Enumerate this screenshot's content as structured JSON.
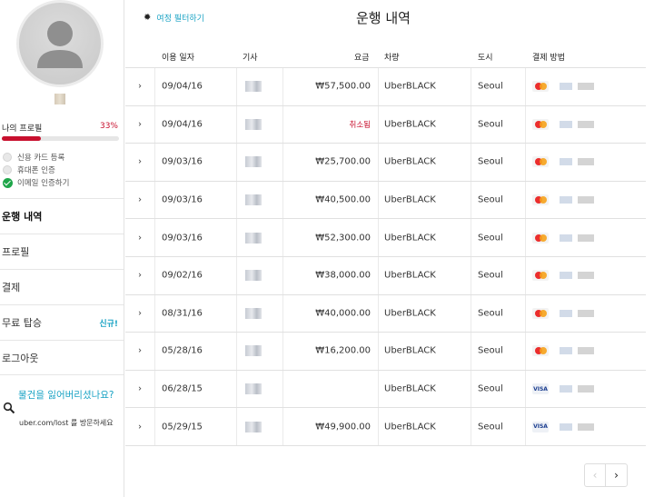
{
  "sidebar": {
    "profile_label": "나의 프로필",
    "profile_percent": "33%",
    "profile_progress": 0.33,
    "tasks": [
      {
        "label": "신용 카드 등록",
        "done": false
      },
      {
        "label": "휴대폰 인증",
        "done": false
      },
      {
        "label": "이메일 인증하기",
        "done": true
      }
    ],
    "nav": [
      {
        "label": "운행 내역",
        "active": true,
        "badge": ""
      },
      {
        "label": "프로필",
        "active": false,
        "badge": ""
      },
      {
        "label": "결제",
        "active": false,
        "badge": ""
      },
      {
        "label": "무료 탑승",
        "active": false,
        "badge": "신규!"
      },
      {
        "label": "로그아웃",
        "active": false,
        "badge": ""
      }
    ],
    "lost_title": "물건을 잃어버리셨나요?",
    "lost_sub": "uber.com/lost 를 방문하세요"
  },
  "header": {
    "filter_label": "여정 필터하기",
    "title": "운행 내역"
  },
  "table": {
    "columns": [
      "이용 일자",
      "기사",
      "요금",
      "차량",
      "도시",
      "결제 방법"
    ],
    "rows": [
      {
        "date": "09/04/16",
        "fare": "₩57,500.00",
        "cancelled": false,
        "vehicle": "UberBLACK",
        "city": "Seoul",
        "card": "mastercard"
      },
      {
        "date": "09/04/16",
        "fare": "취소됨",
        "cancelled": true,
        "vehicle": "UberBLACK",
        "city": "Seoul",
        "card": "mastercard"
      },
      {
        "date": "09/03/16",
        "fare": "₩25,700.00",
        "cancelled": false,
        "vehicle": "UberBLACK",
        "city": "Seoul",
        "card": "mastercard"
      },
      {
        "date": "09/03/16",
        "fare": "₩40,500.00",
        "cancelled": false,
        "vehicle": "UberBLACK",
        "city": "Seoul",
        "card": "mastercard"
      },
      {
        "date": "09/03/16",
        "fare": "₩52,300.00",
        "cancelled": false,
        "vehicle": "UberBLACK",
        "city": "Seoul",
        "card": "mastercard"
      },
      {
        "date": "09/02/16",
        "fare": "₩38,000.00",
        "cancelled": false,
        "vehicle": "UberBLACK",
        "city": "Seoul",
        "card": "mastercard"
      },
      {
        "date": "08/31/16",
        "fare": "₩40,000.00",
        "cancelled": false,
        "vehicle": "UberBLACK",
        "city": "Seoul",
        "card": "mastercard"
      },
      {
        "date": "05/28/16",
        "fare": "₩16,200.00",
        "cancelled": false,
        "vehicle": "UberBLACK",
        "city": "Seoul",
        "card": "mastercard"
      },
      {
        "date": "06/28/15",
        "fare": "",
        "cancelled": false,
        "vehicle": "UberBLACK",
        "city": "Seoul",
        "card": "visa"
      },
      {
        "date": "05/29/15",
        "fare": "₩49,900.00",
        "cancelled": false,
        "vehicle": "UberBLACK",
        "city": "Seoul",
        "card": "visa"
      }
    ],
    "visa_text": "VISA"
  },
  "pager": {
    "prev": "‹",
    "next": "›"
  },
  "colors": {
    "accent": "#1aa3c4",
    "alert": "#c8102e",
    "success": "#1fa64a"
  }
}
